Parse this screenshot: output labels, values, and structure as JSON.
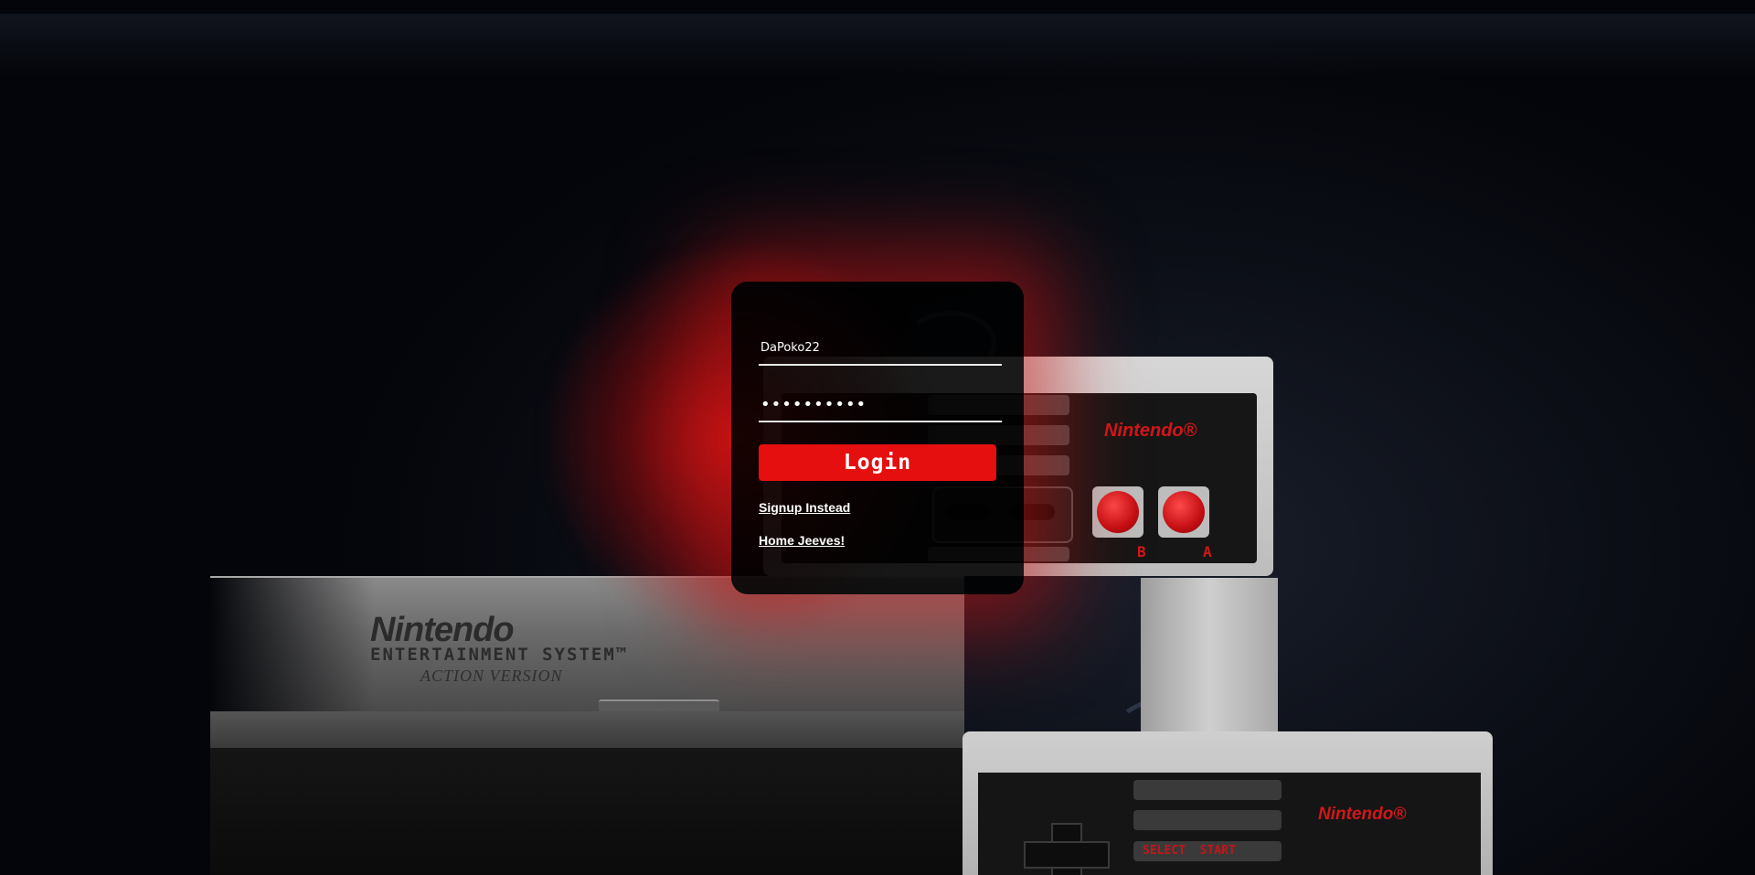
{
  "login_form": {
    "username_value": "DaPoko22",
    "password_value": "••••••••••",
    "login_label": "Login",
    "signup_link": "Signup Instead",
    "home_link": "Home Jeeves!"
  },
  "background": {
    "console_logo": "Nintendo",
    "console_subtitle": "ENTERTAINMENT SYSTEM™",
    "console_version": "ACTION VERSION",
    "controller_logo": "Nintendo®",
    "controller_labels": {
      "select_start": "SELECT  START",
      "button_b": "B",
      "button_a": "A"
    }
  },
  "colors": {
    "accent": "#e50f0f",
    "card": "#000000",
    "glow": "#d01212"
  }
}
